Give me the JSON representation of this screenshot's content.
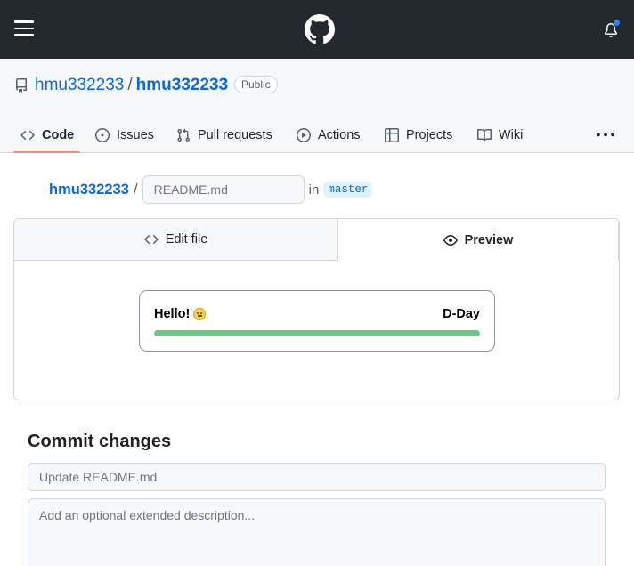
{
  "topbar": {
    "menu_icon": "hamburger-icon",
    "logo_icon": "github-mark-icon",
    "notification_icon": "bell-icon",
    "notification_dot_color": "#2f81f7"
  },
  "repo": {
    "owner": "hmu332233",
    "separator": "/",
    "name": "hmu332233",
    "visibility": "Public"
  },
  "tabs": [
    {
      "label": "Code",
      "icon": "code-icon",
      "active": true
    },
    {
      "label": "Issues",
      "icon": "issue-opened-icon"
    },
    {
      "label": "Pull requests",
      "icon": "git-pull-request-icon"
    },
    {
      "label": "Actions",
      "icon": "play-icon"
    },
    {
      "label": "Projects",
      "icon": "table-icon"
    },
    {
      "label": "Wiki",
      "icon": "book-icon"
    }
  ],
  "tabs_active_color": "#fd8c73",
  "path": {
    "owner": "hmu332233",
    "slash": "/",
    "filename_placeholder": "README.md",
    "in_label": "in",
    "branch": "master"
  },
  "editor": {
    "edit_tab_label": "Edit file",
    "preview_tab_label": "Preview"
  },
  "preview": {
    "hello_text": "Hello!",
    "dday_text": "D-Day",
    "progress_percent": 100,
    "progress_color": "#6cc788"
  },
  "commit": {
    "title": "Commit changes",
    "summary_placeholder": "Update README.md",
    "description_placeholder": "Add an optional extended description..."
  }
}
